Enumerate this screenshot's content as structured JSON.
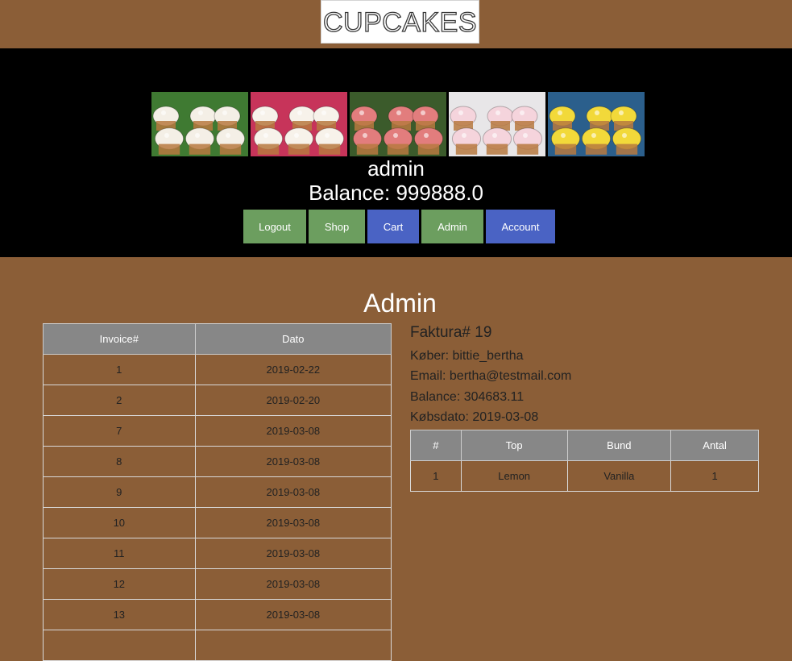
{
  "logo": {
    "text": "CUPCAKES"
  },
  "header": {
    "photos": [
      {
        "icon": "cupcake-photo-icon",
        "frosting": "#f4efe6",
        "bg": "#3f7a32"
      },
      {
        "icon": "cupcake-photo-icon",
        "frosting": "#f7f2ea",
        "bg": "#c7345a"
      },
      {
        "icon": "cupcake-photo-icon",
        "frosting": "#e27d7d",
        "bg": "#3b5b2b"
      },
      {
        "icon": "cupcake-photo-icon",
        "frosting": "#f5d4dc",
        "bg": "#e8e6e8"
      },
      {
        "icon": "cupcake-photo-icon",
        "frosting": "#f2d93a",
        "bg": "#2b5f8c"
      }
    ],
    "username": "admin",
    "balance": "Balance: 999888.0"
  },
  "nav": {
    "items": [
      {
        "label": "Logout",
        "color": "#6c9e5f"
      },
      {
        "label": "Shop",
        "color": "#6c9e5f"
      },
      {
        "label": "Cart",
        "color": "#4a63c4"
      },
      {
        "label": "Admin",
        "color": "#6c9e5f"
      },
      {
        "label": "Account",
        "color": "#4a63c4"
      }
    ]
  },
  "admin": {
    "title": "Admin",
    "invoice_table": {
      "headers": [
        "Invoice#",
        "Dato"
      ],
      "rows": [
        [
          "1",
          "2019-02-22"
        ],
        [
          "2",
          "2019-02-20"
        ],
        [
          "7",
          "2019-03-08"
        ],
        [
          "8",
          "2019-03-08"
        ],
        [
          "9",
          "2019-03-08"
        ],
        [
          "10",
          "2019-03-08"
        ],
        [
          "11",
          "2019-03-08"
        ],
        [
          "12",
          "2019-03-08"
        ],
        [
          "13",
          "2019-03-08"
        ],
        [
          "",
          ""
        ]
      ]
    },
    "detail": {
      "title": "Faktura# 19",
      "buyer": "Køber: bittie_bertha",
      "email": "Email: bertha@testmail.com",
      "balance": "Balance: 304683.11",
      "date": "Købsdato: 2019-03-08",
      "order_table": {
        "headers": [
          "#",
          "Top",
          "Bund",
          "Antal"
        ],
        "rows": [
          [
            "1",
            "Lemon",
            "Vanilla",
            "1"
          ]
        ]
      }
    }
  },
  "colors": {
    "page_bg": "#8b5e37",
    "band_bg": "#000000",
    "green_button": "#6c9e5f",
    "blue_button": "#4a63c4",
    "table_header": "#878787"
  }
}
